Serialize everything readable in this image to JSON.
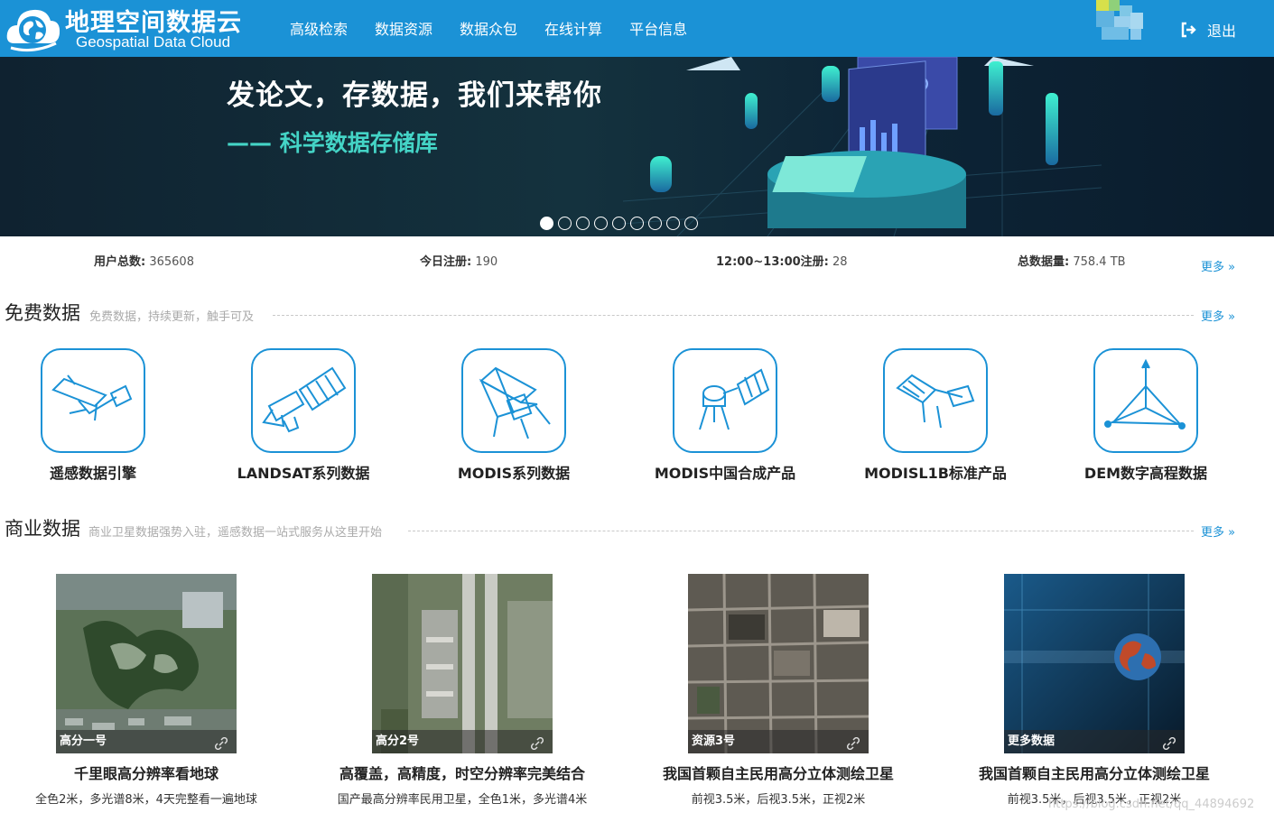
{
  "header": {
    "logo_cn": "地理空间数据云",
    "logo_en": "Geospatial Data Cloud",
    "nav": [
      "高级检索",
      "数据资源",
      "数据众包",
      "在线计算",
      "平台信息"
    ],
    "logout": "退出"
  },
  "banner": {
    "title": "发论文，存数据，我们来帮你",
    "subtitle": "—— 科学数据存储库",
    "slides": 9,
    "active_slide": 1
  },
  "stats": [
    {
      "label": "用户总数:",
      "value": "365608"
    },
    {
      "label": "今日注册:",
      "value": "190"
    },
    {
      "label": "12:00~13:00注册:",
      "value": "28"
    },
    {
      "label": "总数据量:",
      "value": "758.4 TB"
    }
  ],
  "more_label": "更多",
  "free_section": {
    "title": "免费数据",
    "desc": "免费数据，持续更新，触手可及",
    "items": [
      {
        "label": "遥感数据引擎",
        "icon": "satellite-icon"
      },
      {
        "label": "LANDSAT系列数据",
        "icon": "landsat-satellite-icon"
      },
      {
        "label": "MODIS系列数据",
        "icon": "modis-sensor-icon"
      },
      {
        "label": "MODIS中国合成产品",
        "icon": "satellite-dish-icon"
      },
      {
        "label": "MODISL1B标准产品",
        "icon": "satellite-panel-icon"
      },
      {
        "label": "DEM数字高程数据",
        "icon": "dem-axes-icon"
      }
    ]
  },
  "commercial_section": {
    "title": "商业数据",
    "desc": "商业卫星数据强势入驻，遥感数据一站式服务从这里开始",
    "items": [
      {
        "caption": "高分一号",
        "title": "千里眼高分辨率看地球",
        "desc": "全色2米，多光谱8米，4天完整看一遍地球"
      },
      {
        "caption": "高分2号",
        "title": "高覆盖，高精度，时空分辨率完美结合",
        "desc": "国产最高分辨率民用卫星，全色1米，多光谱4米"
      },
      {
        "caption": "资源3号",
        "title": "我国首颗自主民用高分立体测绘卫星",
        "desc": "前视3.5米，后视3.5米，正视2米"
      },
      {
        "caption": "更多数据",
        "title": "我国首颗自主民用高分立体测绘卫星",
        "desc": "前视3.5米，后视3.5米，正视2米"
      }
    ]
  },
  "watermark": "https://blog.csdn.net/qq_44894692"
}
